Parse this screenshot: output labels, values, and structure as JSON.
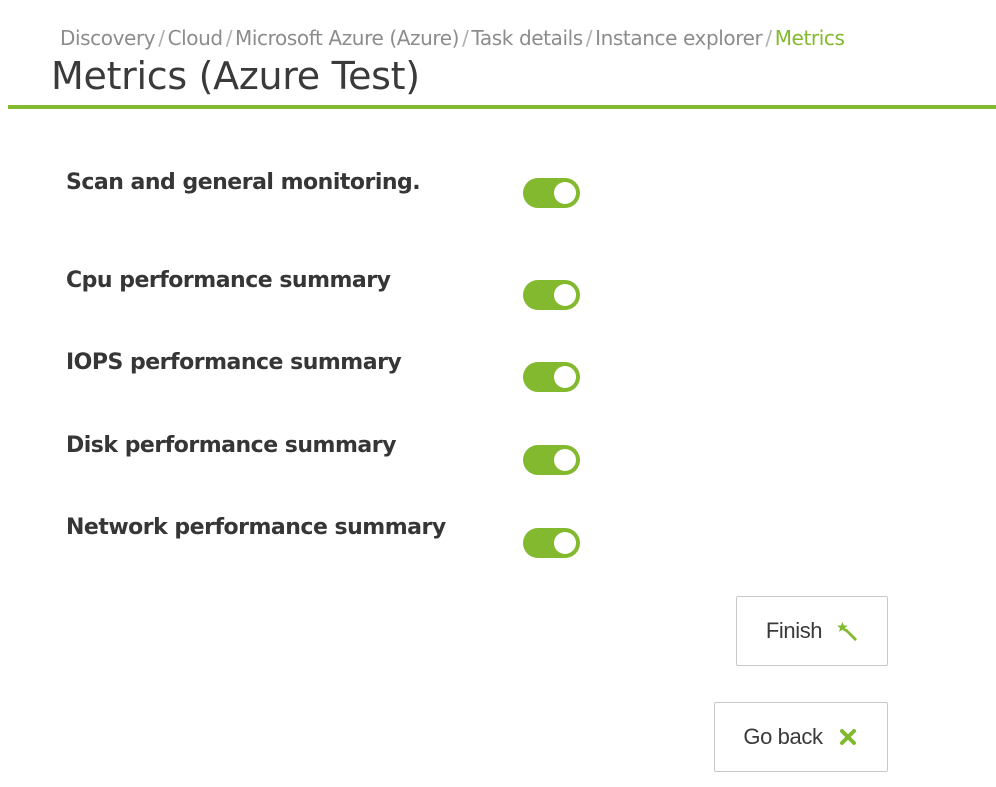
{
  "breadcrumb": {
    "items": [
      "Discovery",
      "Cloud",
      "Microsoft Azure (Azure)",
      "Task details",
      "Instance explorer",
      "Metrics"
    ],
    "separator": "/"
  },
  "page": {
    "title": "Metrics (Azure Test)"
  },
  "metrics": [
    {
      "label": "Scan and general monitoring.",
      "enabled": true
    },
    {
      "label": "Cpu performance summary",
      "enabled": true
    },
    {
      "label": "IOPS performance summary",
      "enabled": true
    },
    {
      "label": "Disk performance summary",
      "enabled": true
    },
    {
      "label": "Network performance summary",
      "enabled": true
    }
  ],
  "actions": {
    "finish_label": "Finish",
    "finish_icon": "magic-wand-icon",
    "goback_label": "Go back",
    "goback_icon": "close-x-icon"
  },
  "colors": {
    "accent": "#82b92e",
    "text": "#363636",
    "breadcrumb": "#8c8c8c"
  }
}
